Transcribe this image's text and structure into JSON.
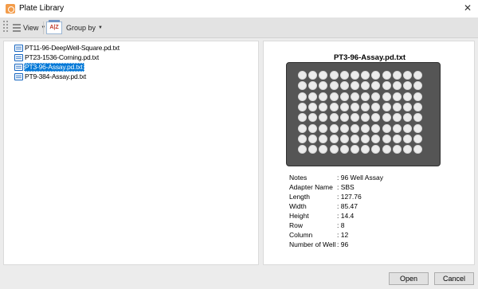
{
  "window": {
    "title": "Plate Library",
    "close_glyph": "✕"
  },
  "toolbar": {
    "view_label": "View",
    "group_by_label": "Group by",
    "group_icon_text": "A|Z"
  },
  "files": [
    {
      "name": "PT11-96-DeepWell-Square.pd.txt",
      "selected": false
    },
    {
      "name": "PT23-1536-Corning.pd.txt",
      "selected": false
    },
    {
      "name": "PT3-96-Assay.pd.txt",
      "selected": true
    },
    {
      "name": "PT9-384-Assay.pd.txt",
      "selected": false
    }
  ],
  "preview": {
    "title": "PT3-96-Assay.pd.txt",
    "plate_rows": 8,
    "plate_cols": 12,
    "plate_color": "#555555",
    "well_color": "#ececec"
  },
  "properties": [
    {
      "key": "Notes",
      "value": ": 96 Well Assay"
    },
    {
      "key": "Adapter Name",
      "value": ": SBS"
    },
    {
      "key": "Length",
      "value": ": 127.76"
    },
    {
      "key": "Width",
      "value": ": 85.47"
    },
    {
      "key": "Height",
      "value": ": 14.4"
    },
    {
      "key": "Row",
      "value": ": 8"
    },
    {
      "key": "Column",
      "value": ": 12"
    },
    {
      "key": "Number of Well",
      "value": ": 96"
    }
  ],
  "buttons": {
    "open": "Open",
    "cancel": "Cancel"
  },
  "colors": {
    "selection": "#0078d7",
    "file_icon": "#1565c0",
    "app_icon": "#f39c4a"
  }
}
